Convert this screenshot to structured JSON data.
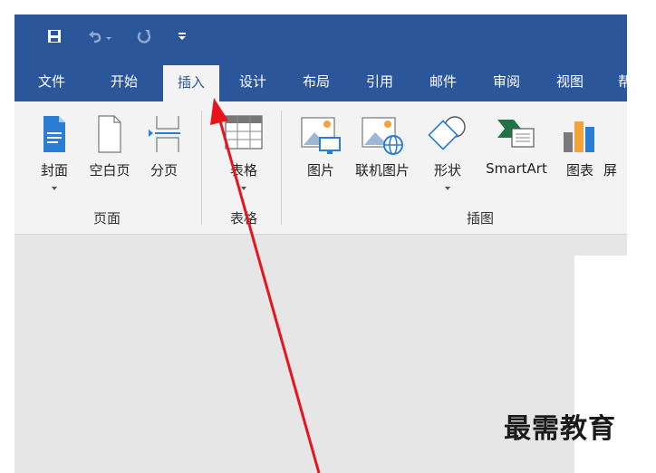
{
  "tabs": [
    {
      "label": "文件"
    },
    {
      "label": "开始"
    },
    {
      "label": "插入",
      "active": true
    },
    {
      "label": "设计"
    },
    {
      "label": "布局"
    },
    {
      "label": "引用"
    },
    {
      "label": "邮件"
    },
    {
      "label": "审阅"
    },
    {
      "label": "视图"
    },
    {
      "label": "帮"
    }
  ],
  "ribbon": {
    "pages": {
      "label": "页面",
      "cover": "封面",
      "blank_page": "空白页",
      "page_break": "分页"
    },
    "tables": {
      "label": "表格",
      "table": "表格"
    },
    "illustrations": {
      "label": "插图",
      "pictures": "图片",
      "online_pictures": "联机图片",
      "shapes": "形状",
      "smartart": "SmartArt",
      "chart": "图表",
      "screenshot": "屏"
    }
  },
  "watermark": "最需教育",
  "colors": {
    "titlebar": "#2b579a",
    "ribbon": "#f3f3f3",
    "canvas": "#e6e6e6",
    "arrow": "#e8141c"
  },
  "icons": [
    "save-icon",
    "undo-icon",
    "redo-icon",
    "customize-qat-icon",
    "cover-icon",
    "blank-page-icon",
    "page-break-icon",
    "table-icon",
    "pictures-icon",
    "online-pictures-icon",
    "shapes-icon",
    "smartart-icon",
    "chart-icon"
  ]
}
